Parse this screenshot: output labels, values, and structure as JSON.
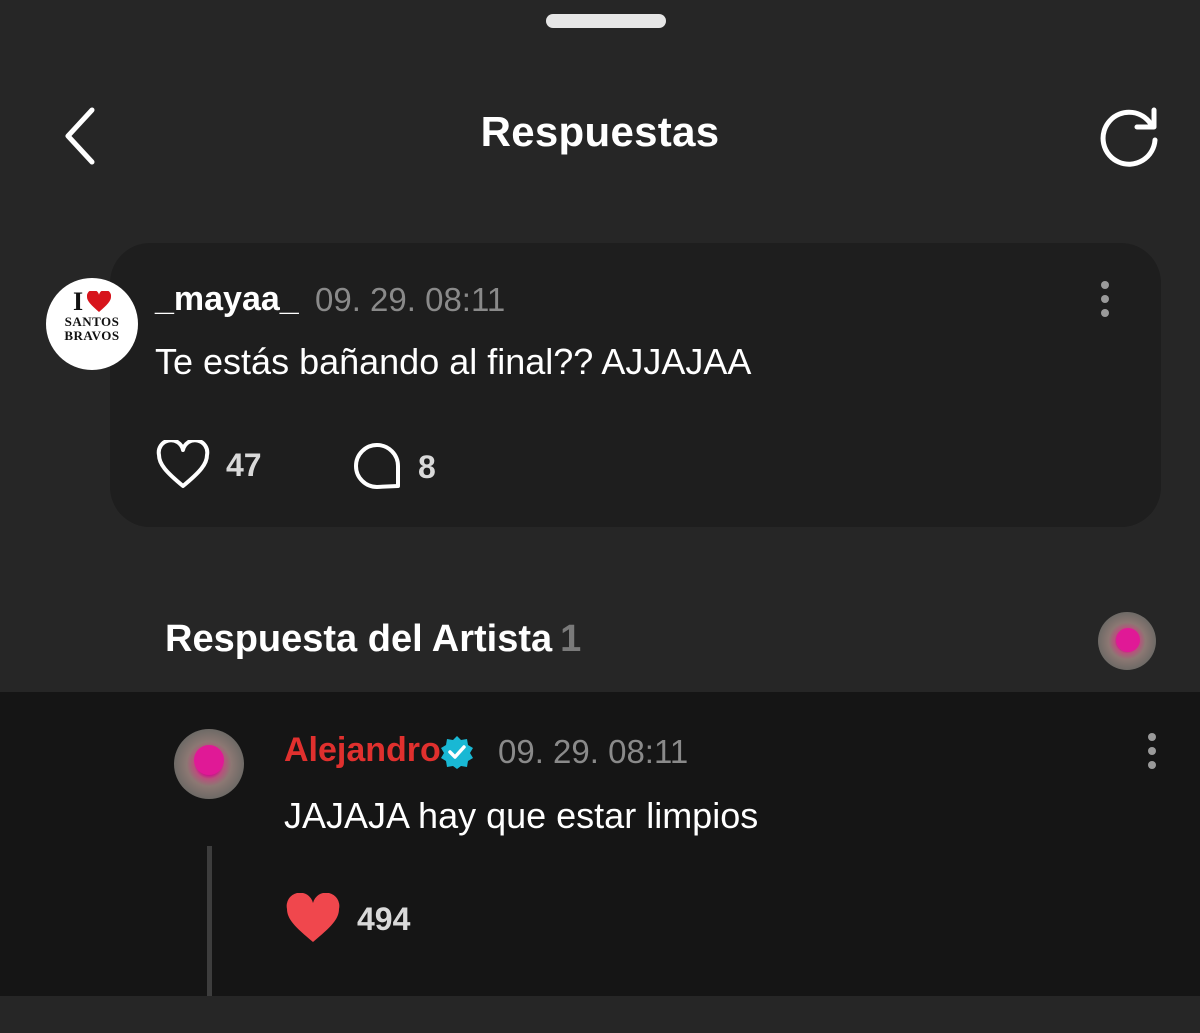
{
  "header": {
    "title": "Respuestas",
    "back_icon": "chevron-left-icon",
    "refresh_icon": "refresh-icon"
  },
  "comment": {
    "avatar_text": {
      "line1": "I",
      "line2": "SANTOS",
      "line3": "BRAVOS"
    },
    "username": "_mayaa_",
    "timestamp": "09. 29. 08:11",
    "text": "Te estás bañando al final?? AJJAJAA",
    "likes": "47",
    "replies": "8"
  },
  "artist_section": {
    "title": "Respuesta del Artista",
    "count": "1"
  },
  "reply": {
    "username": "Alejandro",
    "verified": true,
    "timestamp": "09. 29. 08:11",
    "text": "JAJAJA hay que estar limpios",
    "likes": "494"
  },
  "colors": {
    "background": "#262626",
    "card": "#1e1e1e",
    "reply_background": "#151515",
    "artist_name": "#e0302e",
    "liked_heart": "#f0474d",
    "verified_badge": "#19b8d4",
    "muted_text": "#8a8a8a"
  }
}
